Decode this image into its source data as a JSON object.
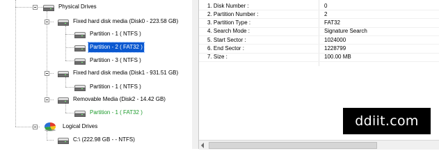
{
  "tree": {
    "physical_drives": "Physical Drives",
    "disk0": "Fixed hard disk media (Disk0 - 223.58 GB)",
    "disk0_part1": "Partition - 1 ( NTFS )",
    "disk0_part2": "Partition - 2 ( FAT32 )",
    "disk0_part3": "Partition - 3 ( NTFS )",
    "disk1": "Fixed hard disk media (Disk1 - 931.51 GB)",
    "disk1_part1": "Partition - 1 ( NTFS )",
    "disk2": "Removable Media (Disk2 - 14.42 GB)",
    "disk2_part1": "Partition - 1 ( FAT32 )",
    "logical_drives": "Logical Drives",
    "drive_c": "C:\\ (222.98 GB -  - NTFS)"
  },
  "properties": [
    {
      "key": "1. Disk Number :",
      "value": "0"
    },
    {
      "key": "2. Partition Number :",
      "value": "2"
    },
    {
      "key": "3. Partition Type :",
      "value": "FAT32"
    },
    {
      "key": "4. Search Mode :",
      "value": "Signature Search"
    },
    {
      "key": "5. Start Sector :",
      "value": "1024000"
    },
    {
      "key": "6. End Sector :",
      "value": "1228799"
    },
    {
      "key": "7. Size :",
      "value": "100.00 MB"
    }
  ],
  "watermark": "ddiit.com",
  "colors": {
    "selection": "#0a58d0",
    "removable_partition": "#1c9a2b"
  }
}
